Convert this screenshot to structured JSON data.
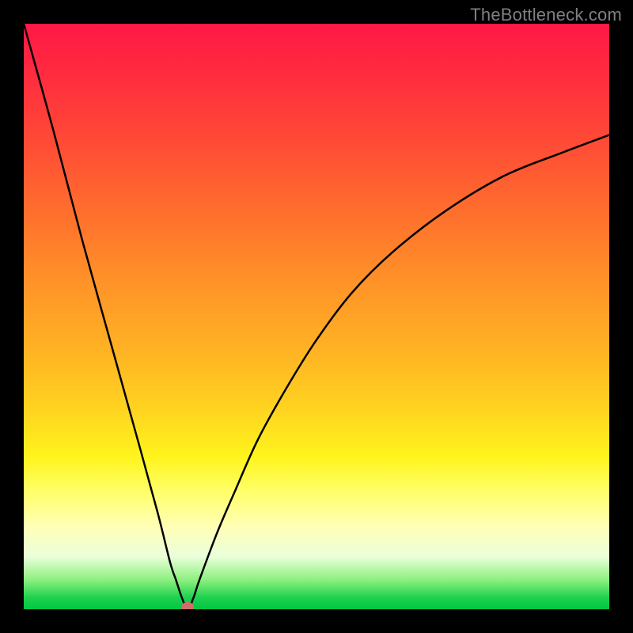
{
  "watermark": "TheBottleneck.com",
  "chart_data": {
    "type": "line",
    "title": "",
    "xlabel": "",
    "ylabel": "",
    "xlim": [
      0,
      100
    ],
    "ylim": [
      0,
      100
    ],
    "series": [
      {
        "name": "bottleneck-curve",
        "x": [
          0,
          5,
          10,
          15,
          20,
          23,
          25,
          26,
          27,
          28,
          29,
          30,
          33,
          36,
          40,
          45,
          50,
          56,
          63,
          72,
          82,
          92,
          100
        ],
        "values": [
          100,
          82,
          63,
          45,
          27,
          16,
          8,
          5,
          2,
          0,
          2,
          5,
          13,
          20,
          29,
          38,
          46,
          54,
          61,
          68,
          74,
          78,
          81
        ]
      }
    ],
    "annotations": [
      {
        "type": "point",
        "name": "minimum-dot",
        "x": 28,
        "y": 0
      }
    ],
    "background_gradient_stops": [
      {
        "pos": 0.0,
        "color": "#ff1846"
      },
      {
        "pos": 0.5,
        "color": "#ffb323"
      },
      {
        "pos": 0.8,
        "color": "#ffff6a"
      },
      {
        "pos": 1.0,
        "color": "#00c742"
      }
    ],
    "grid": false,
    "legend": false
  }
}
